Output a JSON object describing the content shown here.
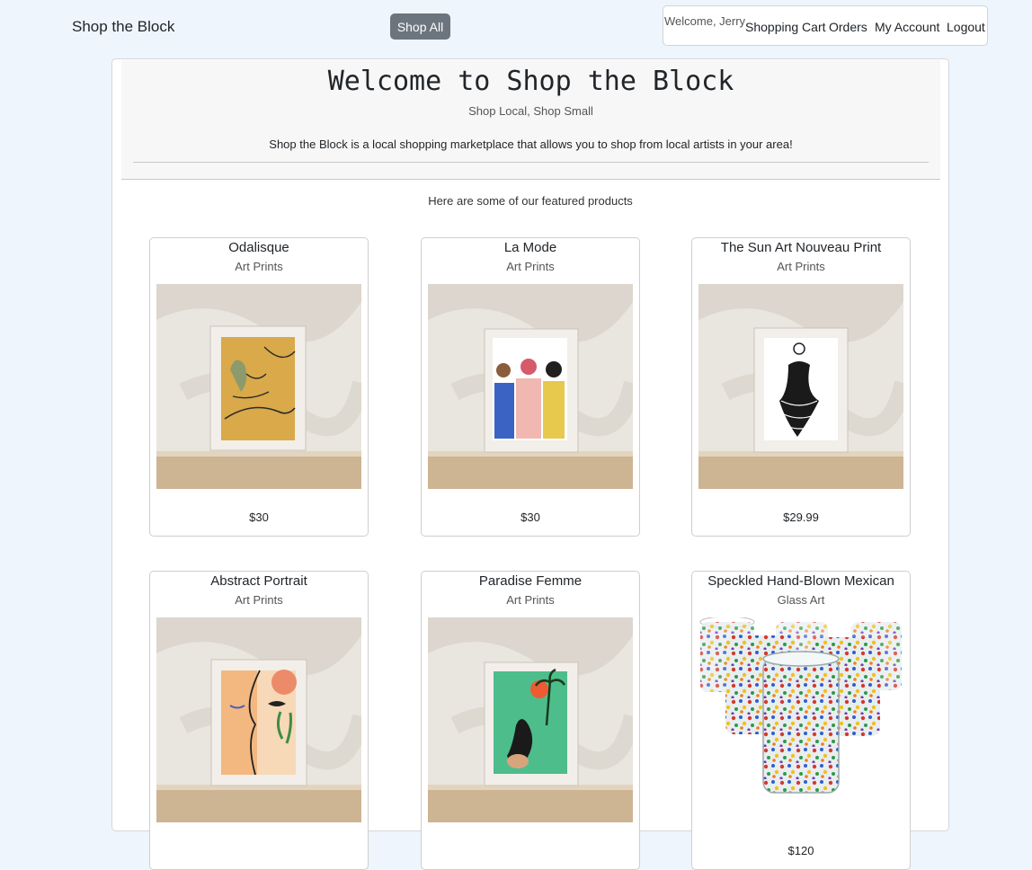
{
  "navbar": {
    "brand": "Shop the Block",
    "shop_all_label": "Shop All",
    "welcome_text": "Welcome, Jerry",
    "links": [
      "Shopping Cart",
      "Orders",
      "My Account",
      "Logout"
    ]
  },
  "hero": {
    "title": "Welcome to Shop the Block",
    "tagline": "Shop Local, Shop Small",
    "description": "Shop the Block is a local shopping marketplace that allows you to shop from local artists in your area!"
  },
  "featured_intro": "Here are some of our featured products",
  "products": [
    {
      "name": "Odalisque",
      "category": "Art Prints",
      "price": "$30",
      "image": "framed-art-print-odalisque"
    },
    {
      "name": "La Mode",
      "category": "Art Prints",
      "price": "$30",
      "image": "framed-art-print-la-mode"
    },
    {
      "name": "The Sun Art Nouveau Print",
      "category": "Art Prints",
      "price": "$29.99",
      "image": "framed-art-print-sun"
    },
    {
      "name": "Abstract Portrait",
      "category": "Art Prints",
      "price": "",
      "image": "framed-art-print-abstract-portrait"
    },
    {
      "name": "Paradise Femme",
      "category": "Art Prints",
      "price": "",
      "image": "framed-art-print-paradise-femme"
    },
    {
      "name": "Speckled Hand-Blown Mexican",
      "category": "Glass Art",
      "price": "$120",
      "image": "speckled-glass-tumblers"
    }
  ],
  "colors": {
    "page_background": "#eef5fd",
    "shop_all_button": "#6c757d",
    "jumbotron_background": "#f7f7f7"
  }
}
